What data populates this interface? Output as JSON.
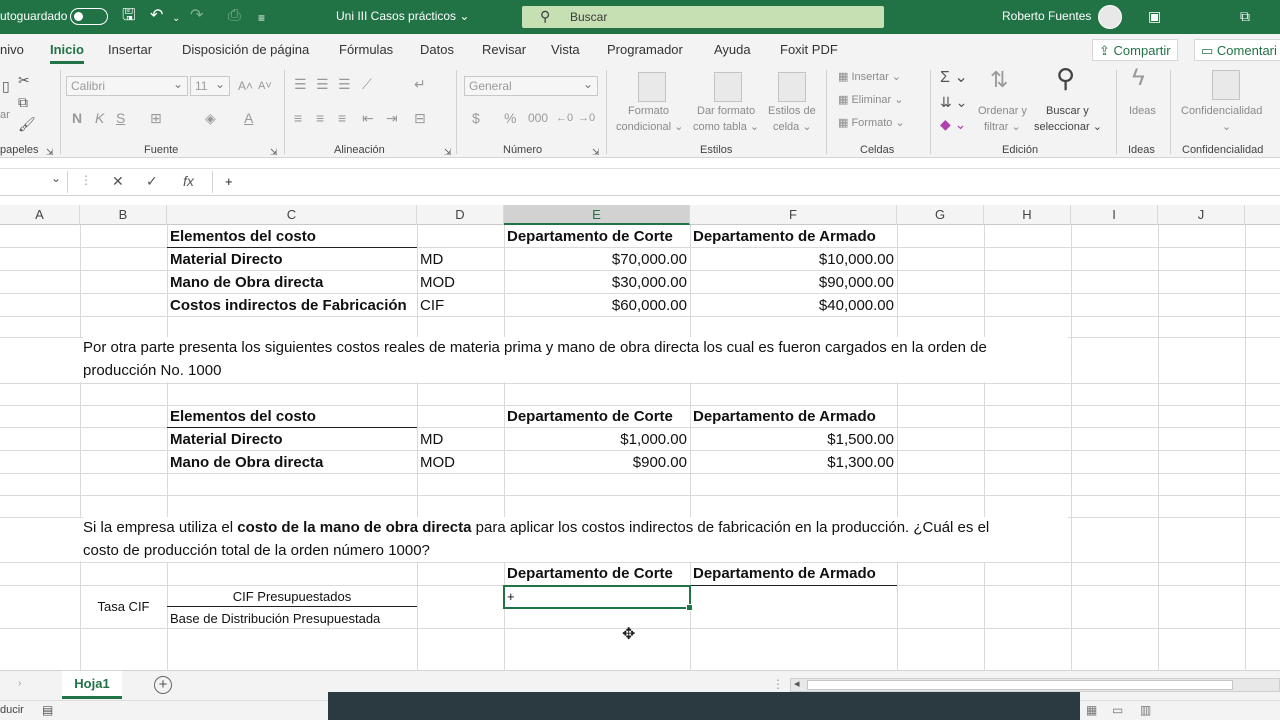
{
  "titlebar": {
    "autosave": "utoguardado",
    "filename": "Uni III Casos prácticos",
    "search": "Buscar",
    "user": "Roberto Fuentes"
  },
  "tabs": [
    "nivo",
    "Inicio",
    "Insertar",
    "Disposición de página",
    "Fórmulas",
    "Datos",
    "Revisar",
    "Vista",
    "Programador",
    "Ayuda",
    "Foxit PDF"
  ],
  "tab_buttons": {
    "share": "Compartir",
    "comments": "Comentari"
  },
  "ribbon": {
    "groups": {
      "clipboard": "papeles",
      "font": "Fuente",
      "alignment": "Alineación",
      "number": "Número",
      "styles": "Estilos",
      "cells": "Celdas",
      "editing": "Edición",
      "ideas": "Ideas",
      "confidentiality": "Confidencialidad"
    },
    "clip_ar": "ar",
    "font_name": "Calibri",
    "font_size": "11",
    "number_format": "General",
    "bold": "N",
    "italic": "K",
    "underline": "S",
    "cond_format_1": "Formato",
    "cond_format_2": "condicional",
    "table_format_1": "Dar formato",
    "table_format_2": "como tabla",
    "cell_styles_1": "Estilos de",
    "cell_styles_2": "celda",
    "insert": "Insertar",
    "delete": "Eliminar",
    "format": "Formato",
    "sort_1": "Ordenar y",
    "sort_2": "filtrar",
    "find_1": "Buscar y",
    "find_2": "seleccionar",
    "ideas_btn": "Ideas",
    "conf_btn": "Confidencialidad"
  },
  "formula": {
    "content": "+"
  },
  "columns": [
    "A",
    "B",
    "C",
    "D",
    "E",
    "F",
    "G",
    "H",
    "I",
    "J"
  ],
  "table1": {
    "header": [
      "Elementos del costo",
      "Departamento de Corte",
      "Departamento de Armado"
    ],
    "rows": [
      {
        "label": "Material Directo",
        "code": "MD",
        "corte": "$70,000.00",
        "armado": "$10,000.00"
      },
      {
        "label": "Mano de Obra directa",
        "code": "MOD",
        "corte": "$30,000.00",
        "armado": "$90,000.00"
      },
      {
        "label": "Costos indirectos de Fabricación",
        "code": "CIF",
        "corte": "$60,000.00",
        "armado": "$40,000.00"
      }
    ]
  },
  "paragraph1": {
    "line1": "Por otra parte presenta los siguientes costos reales de materia prima y mano de obra directa los cual es fueron cargados en la orden de",
    "line2": "producción No. 1000"
  },
  "table2": {
    "header": [
      "Elementos del costo",
      "Departamento de Corte",
      "Departamento de Armado"
    ],
    "rows": [
      {
        "label": "Material Directo",
        "code": "MD",
        "corte": "$1,000.00",
        "armado": "$1,500.00"
      },
      {
        "label": "Mano de Obra directa",
        "code": "MOD",
        "corte": "$900.00",
        "armado": "$1,300.00"
      }
    ]
  },
  "paragraph2": {
    "pre": "Si la empresa utiliza el ",
    "bold": "costo de la mano de obra directa",
    "post": " para aplicar los costos indirectos de fabricación en la producción. ¿Cuál es el",
    "line2": "costo de producción total de la orden número 1000?"
  },
  "table3": {
    "header": [
      "Departamento de Corte",
      "Departamento de Armado"
    ],
    "tasa": "Tasa CIF",
    "numerator": "CIF Presupuestados",
    "denominator": "Base de Distribución Presupuestada",
    "active_cell": "+"
  },
  "sheet": {
    "tab": "Hoja1"
  },
  "status": {
    "text": "ducir"
  }
}
